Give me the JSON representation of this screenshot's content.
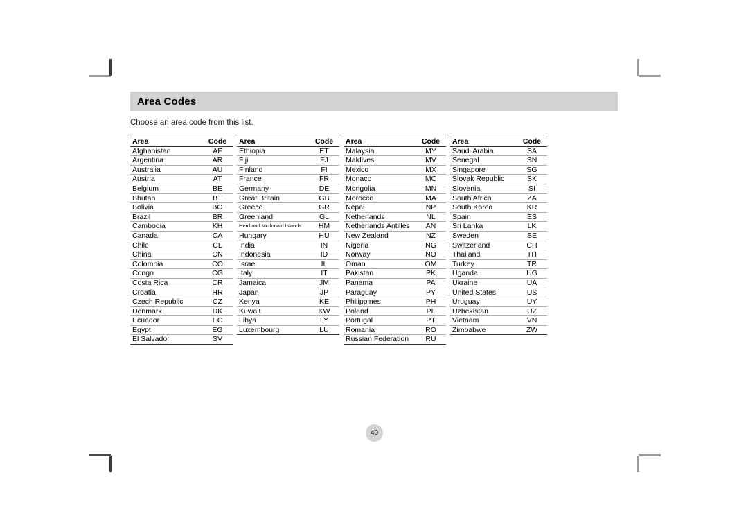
{
  "document": {
    "title": "Area Codes",
    "subtitle": "Choose an area code from this list.",
    "page_number": "40"
  },
  "table": {
    "headers": {
      "area": "Area",
      "code": "Code"
    },
    "column_groups": [
      {
        "rows": [
          {
            "area": "Afghanistan",
            "code": "AF"
          },
          {
            "area": "Argentina",
            "code": "AR"
          },
          {
            "area": "Australia",
            "code": "AU"
          },
          {
            "area": "Austria",
            "code": "AT"
          },
          {
            "area": "Belgium",
            "code": "BE"
          },
          {
            "area": "Bhutan",
            "code": "BT"
          },
          {
            "area": "Bolivia",
            "code": "BO"
          },
          {
            "area": "Brazil",
            "code": "BR"
          },
          {
            "area": "Cambodia",
            "code": "KH"
          },
          {
            "area": "Canada",
            "code": "CA"
          },
          {
            "area": "Chile",
            "code": "CL"
          },
          {
            "area": "China",
            "code": "CN"
          },
          {
            "area": "Colombia",
            "code": "CO"
          },
          {
            "area": "Congo",
            "code": "CG"
          },
          {
            "area": "Costa Rica",
            "code": "CR"
          },
          {
            "area": "Croatia",
            "code": "HR"
          },
          {
            "area": "Czech Republic",
            "code": "CZ"
          },
          {
            "area": "Denmark",
            "code": "DK"
          },
          {
            "area": "Ecuador",
            "code": "EC"
          },
          {
            "area": "Egypt",
            "code": "EG"
          },
          {
            "area": "El Salvador",
            "code": "SV"
          }
        ]
      },
      {
        "rows": [
          {
            "area": "Ethiopia",
            "code": "ET"
          },
          {
            "area": "Fiji",
            "code": "FJ"
          },
          {
            "area": "Finland",
            "code": "FI"
          },
          {
            "area": "France",
            "code": "FR"
          },
          {
            "area": "Germany",
            "code": "DE"
          },
          {
            "area": "Great Britain",
            "code": "GB"
          },
          {
            "area": "Greece",
            "code": "GR"
          },
          {
            "area": "Greenland",
            "code": "GL"
          },
          {
            "area": "Herd and Mcdonald Islands",
            "code": "HM",
            "small": true
          },
          {
            "area": "Hungary",
            "code": "HU"
          },
          {
            "area": "India",
            "code": "IN"
          },
          {
            "area": "Indonesia",
            "code": "ID"
          },
          {
            "area": "Israel",
            "code": "IL"
          },
          {
            "area": "Italy",
            "code": "IT"
          },
          {
            "area": "Jamaica",
            "code": "JM"
          },
          {
            "area": "Japan",
            "code": "JP"
          },
          {
            "area": "Kenya",
            "code": "KE"
          },
          {
            "area": "Kuwait",
            "code": "KW"
          },
          {
            "area": "Libya",
            "code": "LY"
          },
          {
            "area": "Luxembourg",
            "code": "LU"
          }
        ]
      },
      {
        "rows": [
          {
            "area": "Malaysia",
            "code": "MY"
          },
          {
            "area": "Maldives",
            "code": "MV"
          },
          {
            "area": "Mexico",
            "code": "MX"
          },
          {
            "area": "Monaco",
            "code": "MC"
          },
          {
            "area": "Mongolia",
            "code": "MN"
          },
          {
            "area": "Morocco",
            "code": "MA"
          },
          {
            "area": "Nepal",
            "code": "NP"
          },
          {
            "area": "Netherlands",
            "code": "NL"
          },
          {
            "area": "Netherlands Antilles",
            "code": "AN"
          },
          {
            "area": "New Zealand",
            "code": "NZ"
          },
          {
            "area": "Nigeria",
            "code": "NG"
          },
          {
            "area": "Norway",
            "code": "NO"
          },
          {
            "area": "Oman",
            "code": "OM"
          },
          {
            "area": "Pakistan",
            "code": "PK"
          },
          {
            "area": "Panama",
            "code": "PA"
          },
          {
            "area": "Paraguay",
            "code": "PY"
          },
          {
            "area": "Philippines",
            "code": "PH"
          },
          {
            "area": "Poland",
            "code": "PL"
          },
          {
            "area": "Portugal",
            "code": "PT"
          },
          {
            "area": "Romania",
            "code": "RO"
          },
          {
            "area": "Russian Federation",
            "code": "RU"
          }
        ]
      },
      {
        "rows": [
          {
            "area": "Saudi Arabia",
            "code": "SA"
          },
          {
            "area": "Senegal",
            "code": "SN"
          },
          {
            "area": "Singapore",
            "code": "SG"
          },
          {
            "area": "Slovak Republic",
            "code": "SK"
          },
          {
            "area": "Slovenia",
            "code": "SI"
          },
          {
            "area": "South Africa",
            "code": "ZA"
          },
          {
            "area": "South Korea",
            "code": "KR"
          },
          {
            "area": "Spain",
            "code": "ES"
          },
          {
            "area": "Sri Lanka",
            "code": "LK"
          },
          {
            "area": "Sweden",
            "code": "SE"
          },
          {
            "area": "Switzerland",
            "code": "CH"
          },
          {
            "area": "Thailand",
            "code": "TH"
          },
          {
            "area": "Turkey",
            "code": "TR"
          },
          {
            "area": "Uganda",
            "code": "UG"
          },
          {
            "area": "Ukraine",
            "code": "UA"
          },
          {
            "area": "United States",
            "code": "US"
          },
          {
            "area": "Uruguay",
            "code": "UY"
          },
          {
            "area": "Uzbekistan",
            "code": "UZ"
          },
          {
            "area": "Vietnam",
            "code": "VN"
          },
          {
            "area": "Zimbabwe",
            "code": "ZW"
          }
        ]
      }
    ]
  },
  "colors": {
    "title_bar_background": "#d2d2d2",
    "page_number_background": "#d4d4d4",
    "rule_dark": "#333333",
    "rule_light": "#aeaeae"
  }
}
